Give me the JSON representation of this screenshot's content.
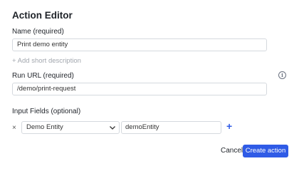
{
  "editor": {
    "title": "Action Editor"
  },
  "name_field": {
    "label": "Name (required)",
    "value": "Print demo entity"
  },
  "add_description_link": "+ Add short description",
  "run_url_field": {
    "label": "Run URL (required)",
    "value": "/demo/print-request",
    "info_icon": "info-icon"
  },
  "input_fields": {
    "label": "Input Fields (optional)",
    "rows": [
      {
        "remove_glyph": "×",
        "entity_type": "Demo Entity",
        "field_value": "demoEntity"
      }
    ],
    "add_glyph": "+"
  },
  "footer": {
    "cancel_label": "Cancel",
    "create_label": "Create action"
  },
  "colors": {
    "accent": "#2f5be6",
    "border": "#d5d9de",
    "muted": "#a2a7ae"
  }
}
